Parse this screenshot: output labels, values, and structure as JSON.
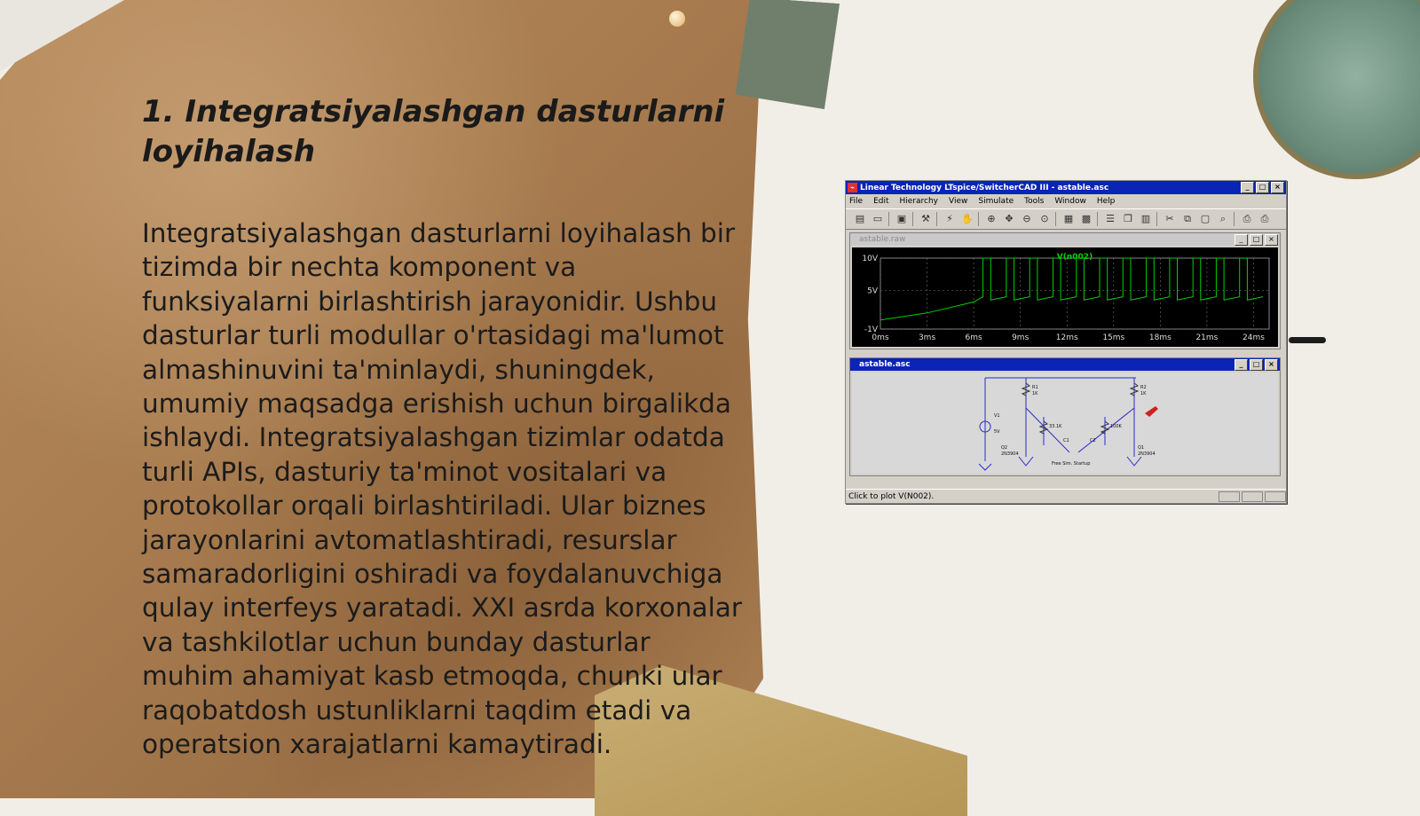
{
  "slide": {
    "title": "1. Integratsiyalashgan dasturlarni loyihalash",
    "body": "Integratsiyalashgan dasturlarni loyihalash bir tizimda bir nechta komponent va funksiyalarni birlashtirish jarayonidir. Ushbu dasturlar turli modullar o'rtasidagi ma'lumot almashinuvini ta'minlaydi, shuningdek, umumiy maqsadga erishish uchun birgalikda ishlaydi. Integratsiyalashgan tizimlar odatda turli APIs, dasturiy ta'minot vositalari va protokollar orqali birlashtiriladi. Ular biznes jarayonlarini avtomatlashtiradi, resurslar samaradorligini oshiradi va foydalanuvchiga qulay interfeys yaratadi. XXI asrda korxonalar va tashkilotlar uchun bunday dasturlar muhim ahamiyat kasb etmoqda, chunki ular raqobatdosh ustunliklarni taqdim etadi va operatsion xarajatlarni kamaytiradi."
  },
  "ltspice": {
    "window_title": "Linear Technology LTspice/SwitcherCAD III - astable.asc",
    "menu": [
      "File",
      "Edit",
      "Hierarchy",
      "View",
      "Simulate",
      "Tools",
      "Window",
      "Help"
    ],
    "plot_window_title": "astable.raw",
    "schematic_window_title": "astable.asc",
    "status": "Click to plot V(N002).",
    "schematic_labels": {
      "r1": "R1",
      "r1v": "1K",
      "r2": "R2",
      "r2v": "1K",
      "v1": "V1",
      "v1v": "5V",
      "q2": "Q2",
      "q2p": "2N3904",
      "q1": "Q1",
      "q1p": "2N3904",
      "r3v": "33.1K",
      "r4v": "100K",
      "c1": "C1",
      "c2": "C2",
      "caption": "Free Sim. Startup"
    }
  },
  "chart_data": {
    "type": "line",
    "series": [
      {
        "name": "V(n002)"
      }
    ],
    "ylabel_ticks": [
      "10V",
      "5V",
      "-1V"
    ],
    "xticks": [
      "0ms",
      "3ms",
      "6ms",
      "9ms",
      "12ms",
      "15ms",
      "18ms",
      "21ms",
      "24ms"
    ],
    "xlim": [
      0,
      25
    ],
    "ylim": [
      -1,
      10
    ],
    "grid": true,
    "trace_color": "#00d000",
    "background": "#000000",
    "waveform": {
      "startup_ramp": [
        [
          0,
          0.4
        ],
        [
          3,
          1.5
        ],
        [
          6,
          3.2
        ],
        [
          6.6,
          4.0
        ]
      ],
      "oscillation_start_ms": 6.6,
      "period_ms": 1.5,
      "high_v": 10,
      "low_v": 3.5,
      "duty": 0.33
    }
  },
  "colors": {
    "titlebar": "#0a24b6",
    "trace": "#00d000"
  }
}
